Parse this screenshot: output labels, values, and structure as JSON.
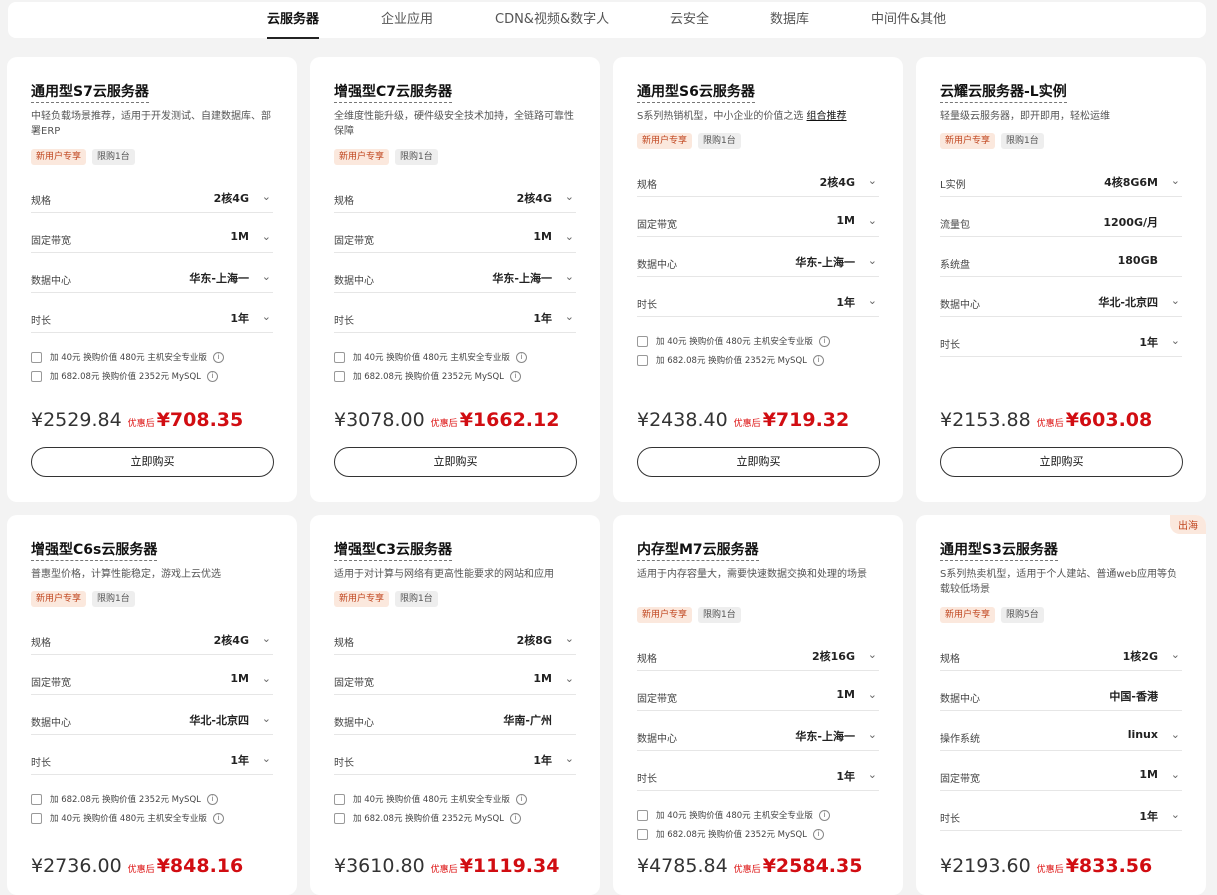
{
  "tabs": [
    "云服务器",
    "企业应用",
    "CDN&视频&数字人",
    "云安全",
    "数据库",
    "中间件&其他"
  ],
  "active_tab_index": 0,
  "buy_label": "立即购买",
  "discount_tag": "优惠后",
  "colors": {
    "accent_red": "#d10d12",
    "badge_orange": "#c0461f",
    "badge_orange_bg": "#fbe8dd"
  },
  "cards": [
    {
      "title": "通用型S7云服务器",
      "desc": "中轻负载场景推荐，适用于开发测试、自建数据库、部署ERP",
      "badges": [
        "新用户专享",
        "限购1台"
      ],
      "specs": [
        {
          "label": "规格",
          "value": "2核4G"
        },
        {
          "label": "固定带宽",
          "value": "1M"
        },
        {
          "label": "数据中心",
          "value": "华东-上海一"
        },
        {
          "label": "时长",
          "value": "1年"
        }
      ],
      "addons": [
        "加 40元 换购价值 480元 主机安全专业版",
        "加 682.08元 换购价值 2352元 MySQL"
      ],
      "orig_price": "¥2529.84",
      "final_price": "¥708.35"
    },
    {
      "title": "增强型C7云服务器",
      "desc": "全维度性能升级，硬件级安全技术加持，全链路可靠性保障",
      "badges": [
        "新用户专享",
        "限购1台"
      ],
      "specs": [
        {
          "label": "规格",
          "value": "2核4G"
        },
        {
          "label": "固定带宽",
          "value": "1M"
        },
        {
          "label": "数据中心",
          "value": "华东-上海一"
        },
        {
          "label": "时长",
          "value": "1年"
        }
      ],
      "addons": [
        "加 40元 换购价值 480元 主机安全专业版",
        "加 682.08元 换购价值 2352元 MySQL"
      ],
      "orig_price": "¥3078.00",
      "final_price": "¥1662.12"
    },
    {
      "title": "通用型S6云服务器",
      "desc": "S系列热销机型，中小企业的价值之选",
      "desc_link": "组合推荐",
      "badges": [
        "新用户专享",
        "限购1台"
      ],
      "specs": [
        {
          "label": "规格",
          "value": "2核4G"
        },
        {
          "label": "固定带宽",
          "value": "1M"
        },
        {
          "label": "数据中心",
          "value": "华东-上海一"
        },
        {
          "label": "时长",
          "value": "1年"
        }
      ],
      "addons": [
        "加 40元 换购价值 480元 主机安全专业版",
        "加 682.08元 换购价值 2352元 MySQL"
      ],
      "orig_price": "¥2438.40",
      "final_price": "¥719.32"
    },
    {
      "title": "云耀云服务器-L实例",
      "desc": "轻量级云服务器，即开即用，轻松运维",
      "badges": [
        "新用户专享",
        "限购1台"
      ],
      "specs": [
        {
          "label": "L实例",
          "value": "4核8G6M"
        },
        {
          "label": "流量包",
          "value": "1200G/月"
        },
        {
          "label": "系统盘",
          "value": "180GB"
        },
        {
          "label": "数据中心",
          "value": "华北-北京四"
        },
        {
          "label": "时长",
          "value": "1年"
        }
      ],
      "addons": [],
      "orig_price": "¥2153.88",
      "final_price": "¥603.08"
    },
    {
      "title": "增强型C6s云服务器",
      "desc": "普惠型价格，计算性能稳定，游戏上云优选",
      "badges": [
        "新用户专享",
        "限购1台"
      ],
      "specs": [
        {
          "label": "规格",
          "value": "2核4G"
        },
        {
          "label": "固定带宽",
          "value": "1M"
        },
        {
          "label": "数据中心",
          "value": "华北-北京四"
        },
        {
          "label": "时长",
          "value": "1年"
        }
      ],
      "addons": [
        "加 682.08元 换购价值 2352元 MySQL",
        "加 40元 换购价值 480元 主机安全专业版"
      ],
      "orig_price": "¥2736.00",
      "final_price": "¥848.16"
    },
    {
      "title": "增强型C3云服务器",
      "desc": "适用于对计算与网络有更高性能要求的网站和应用",
      "badges": [
        "新用户专享",
        "限购1台"
      ],
      "specs": [
        {
          "label": "规格",
          "value": "2核8G"
        },
        {
          "label": "固定带宽",
          "value": "1M"
        },
        {
          "label": "数据中心",
          "value": "华南-广州"
        },
        {
          "label": "时长",
          "value": "1年"
        }
      ],
      "addons": [
        "加 40元 换购价值 480元 主机安全专业版",
        "加 682.08元 换购价值 2352元 MySQL"
      ],
      "orig_price": "¥3610.80",
      "final_price": "¥1119.34"
    },
    {
      "title": "内存型M7云服务器",
      "desc": "适用于内存容量大，需要快速数据交换和处理的场景",
      "badges": [
        "新用户专享",
        "限购1台"
      ],
      "specs": [
        {
          "label": "规格",
          "value": "2核16G"
        },
        {
          "label": "固定带宽",
          "value": "1M"
        },
        {
          "label": "数据中心",
          "value": "华东-上海一"
        },
        {
          "label": "时长",
          "value": "1年"
        }
      ],
      "addons": [
        "加 40元 换购价值 480元 主机安全专业版",
        "加 682.08元 换购价值 2352元 MySQL"
      ],
      "orig_price": "¥4785.84",
      "final_price": "¥2584.35"
    },
    {
      "title": "通用型S3云服务器",
      "corner": "出海",
      "desc": "S系列热卖机型，适用于个人建站、普通web应用等负载较低场景",
      "badges": [
        "新用户专享",
        "限购5台"
      ],
      "specs": [
        {
          "label": "规格",
          "value": "1核2G"
        },
        {
          "label": "数据中心",
          "value": "中国-香港"
        },
        {
          "label": "操作系统",
          "value": "linux"
        },
        {
          "label": "固定带宽",
          "value": "1M"
        },
        {
          "label": "时长",
          "value": "1年"
        }
      ],
      "addons": [],
      "orig_price": "¥2193.60",
      "final_price": "¥833.56"
    }
  ]
}
